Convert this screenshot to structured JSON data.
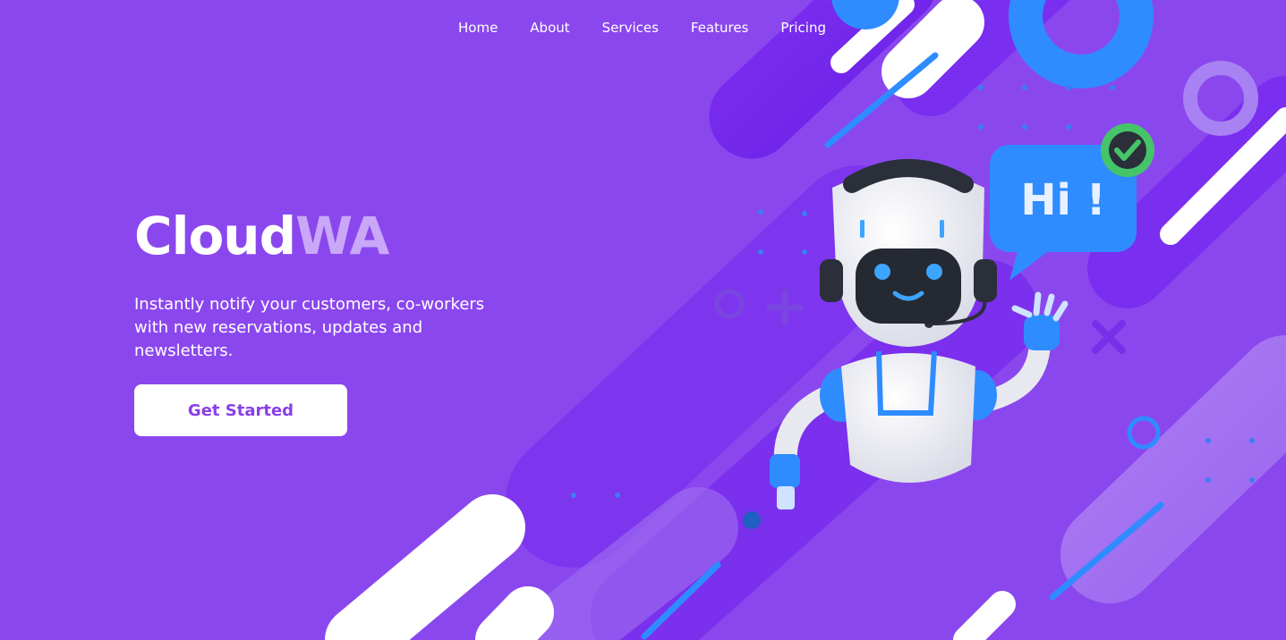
{
  "nav": {
    "items": [
      {
        "label": "Home"
      },
      {
        "label": "About"
      },
      {
        "label": "Services"
      },
      {
        "label": "Features"
      },
      {
        "label": "Pricing"
      }
    ]
  },
  "hero": {
    "brand_part1": "Cloud",
    "brand_part2": "WA",
    "tagline": "Instantly notify your customers, co-workers with new reservations, updates and newsletters.",
    "cta_label": "Get Started"
  },
  "illustration": {
    "speech_bubble_text": "Hi !",
    "icons": [
      "robot-mascot",
      "speech-bubble",
      "check-badge-icon"
    ]
  },
  "colors": {
    "background": "#8b47ee",
    "accent_blue": "#2f8cff",
    "cta_text": "#8a3ee8",
    "brand_secondary": "#c9a8f8"
  }
}
